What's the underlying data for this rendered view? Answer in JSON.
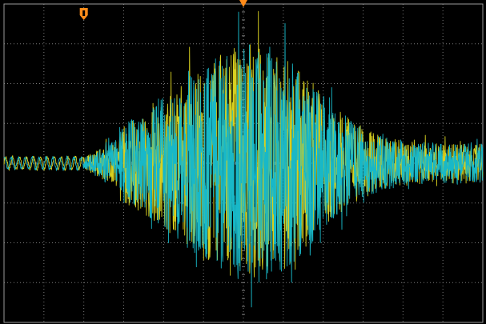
{
  "scope": {
    "background": "#000000",
    "grid_color": "#7a7a7a",
    "border_color": "#9a9a9a",
    "h_divisions": 12,
    "v_divisions": 8,
    "minor_per_division": 5
  },
  "markers": {
    "trigger_position_icon": "trigger-position-marker",
    "center_reference_icon": "horizontal-reference-marker",
    "color": "#ff8c1a"
  },
  "channels": [
    {
      "name": "",
      "color": "#d8d020",
      "icon": "yellow-channel-trace"
    },
    {
      "name": "",
      "color": "#18b8c8",
      "icon": "cyan-channel-trace"
    }
  ],
  "chart_data": {
    "type": "line",
    "title": "",
    "xlabel": "",
    "ylabel": "",
    "grid": true,
    "x_range_div": [
      0,
      12
    ],
    "y_range_div": [
      -4,
      4
    ],
    "pre_trigger_noise_div": 0.15,
    "burst_start_div": 2.0,
    "burst_peak_amplitude_div": 3.0,
    "burst_peak_at_div": 6.3,
    "burst_tail_amplitude_div": 0.5
  }
}
